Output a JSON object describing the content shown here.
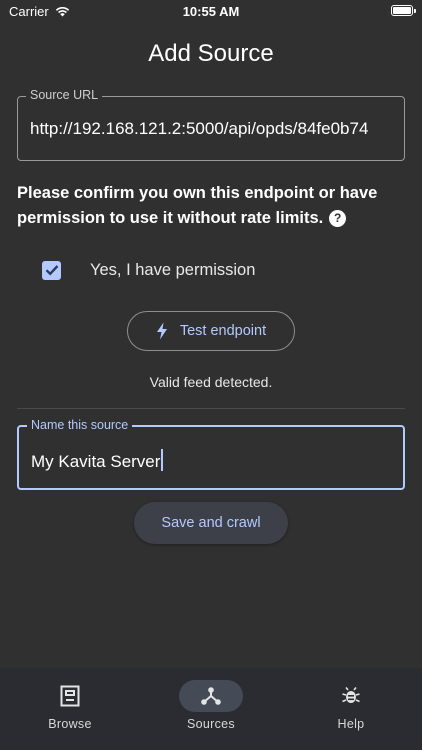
{
  "status_bar": {
    "carrier": "Carrier",
    "time": "10:55 AM"
  },
  "title": "Add Source",
  "source_url": {
    "label": "Source URL",
    "value": "http://192.168.121.2:5000/api/opds/84fe0b74"
  },
  "confirm_text": "Please confirm you own this endpoint or have permission to use it without rate limits.",
  "permission": {
    "label": "Yes, I have permission",
    "checked": true
  },
  "test_button": {
    "label": "Test endpoint"
  },
  "status_message": "Valid feed detected.",
  "source_name": {
    "label": "Name this source",
    "value": "My Kavita Server"
  },
  "save_button": {
    "label": "Save and crawl"
  },
  "nav": {
    "items": [
      {
        "label": "Browse",
        "icon": "browse-icon"
      },
      {
        "label": "Sources",
        "icon": "sources-icon",
        "active": true
      },
      {
        "label": "Help",
        "icon": "bug-icon"
      }
    ]
  },
  "colors": {
    "background": "#303030",
    "accent": "#b3c9ff",
    "nav_background": "#2a2c32",
    "active_pill": "#454a57"
  }
}
